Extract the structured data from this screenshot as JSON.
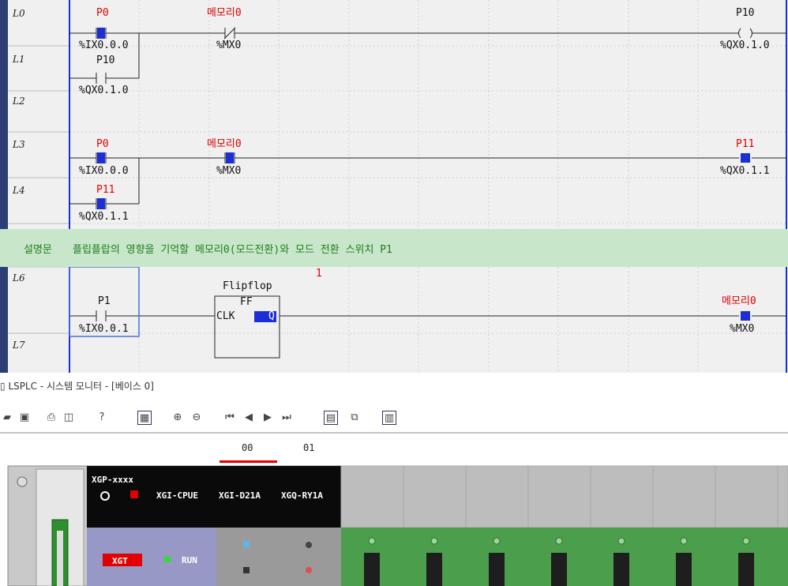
{
  "ladder": {
    "rows": [
      {
        "label": "L0"
      },
      {
        "label": "L1"
      },
      {
        "label": "L2"
      },
      {
        "label": "L3"
      },
      {
        "label": "L4"
      },
      {
        "label": "L6"
      },
      {
        "label": "L7"
      }
    ],
    "contacts": [
      {
        "name": "P0",
        "addr": "%IX0.0.0",
        "color": "#e00000"
      },
      {
        "name": "메모리0",
        "addr": "%MX0",
        "color": "#e00000"
      },
      {
        "name": "P10",
        "addr": "%QX0.1.0",
        "color": "#111111"
      },
      {
        "name": "P10",
        "addr": "%QX0.1.0",
        "color": "#111111"
      },
      {
        "name": "P0",
        "addr": "%IX0.0.0",
        "color": "#e00000"
      },
      {
        "name": "메모리0",
        "addr": "%MX0",
        "color": "#e00000"
      },
      {
        "name": "P11",
        "addr": "%QX0.1.1",
        "color": "#e00000"
      },
      {
        "name": "P11",
        "addr": "%QX0.1.1",
        "color": "#e00000"
      },
      {
        "name": "P1",
        "addr": "%IX0.0.1",
        "color": "#111111"
      },
      {
        "name": "메모리0",
        "addr": "%MX0",
        "color": "#e00000"
      }
    ],
    "comment": {
      "key": "설명문",
      "text": "플립플랍의 영향을 기억할 메모리0(모드전환)와 모드 전환 스위치 P1"
    },
    "flipflop": {
      "title": "Flipflop",
      "type": "FF",
      "in": "CLK",
      "out": "Q",
      "count": "1"
    }
  },
  "monitor": {
    "title": "LSPLC - 시스템 모니터 - [베이스 0]",
    "slots": [
      "00",
      "01"
    ],
    "modules": [
      "XGP-xxxx",
      "XGI-CPUE",
      "XGI-D21A",
      "XGQ-RY1A"
    ],
    "brand": "XGT",
    "run": "RUN"
  },
  "colors": {
    "rail": "#1c2fd6",
    "active": "#1c2fd6",
    "comment_bg": "#c8e6c9",
    "slot_marker": "#e00000"
  }
}
